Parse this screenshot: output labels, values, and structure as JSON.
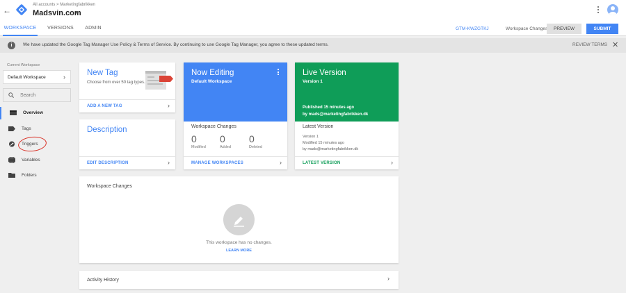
{
  "header": {
    "breadcrumb": "All accounts > Marketingfabrikken",
    "account_name": "Madsvin.com",
    "back_icon": "arrow-left-icon",
    "logo_icon": "gtm-logo-icon"
  },
  "nav": {
    "tabs": [
      {
        "label": "WORKSPACE",
        "active": true
      },
      {
        "label": "VERSIONS",
        "active": false
      },
      {
        "label": "ADMIN",
        "active": false
      }
    ],
    "container_id": "GTM-KWZGTKJ",
    "workspace_changes": "Workspace Changes: 0",
    "preview_label": "PREVIEW",
    "submit_label": "SUBMIT"
  },
  "notice": {
    "text": "We have updated the Google Tag Manager Use Policy & Terms of Service. By continuing to use Google Tag Manager, you agree to these updated terms.",
    "action": "REVIEW TERMS"
  },
  "sidebar": {
    "current_label": "Current Workspace",
    "workspace": "Default Workspace",
    "search_placeholder": "Search",
    "items": [
      {
        "label": "Overview",
        "icon": "overview-icon",
        "active": true
      },
      {
        "label": "Tags",
        "icon": "tag-icon",
        "active": false
      },
      {
        "label": "Triggers",
        "icon": "trigger-icon",
        "active": false
      },
      {
        "label": "Variables",
        "icon": "variables-icon",
        "active": false
      },
      {
        "label": "Folders",
        "icon": "folder-icon",
        "active": false
      }
    ]
  },
  "cards": {
    "new_tag": {
      "title": "New Tag",
      "desc": "Choose from over 50 tag types.",
      "link": "ADD A NEW TAG"
    },
    "description": {
      "title": "Description",
      "link": "EDIT DESCRIPTION"
    },
    "now_editing": {
      "title": "Now Editing",
      "subtitle": "Default Workspace",
      "section": "Workspace Changes",
      "stats": [
        {
          "value": "0",
          "label": "Modified"
        },
        {
          "value": "0",
          "label": "Added"
        },
        {
          "value": "0",
          "label": "Deleted"
        }
      ],
      "link": "MANAGE WORKSPACES",
      "color": "#4285f4"
    },
    "live_version": {
      "title": "Live Version",
      "subtitle": "Version 1",
      "published": "Published 15 minutes ago",
      "by": "by mads@marketingfabrikken.dk",
      "section": "Latest Version",
      "lines": [
        "Version 1",
        "Modified 15 minutes ago",
        "by mads@marketingfabrikken.dk"
      ],
      "link": "LATEST VERSION",
      "color": "#0f9d58"
    },
    "workspace_changes": {
      "title": "Workspace Changes",
      "empty": "This workspace has no changes.",
      "link": "LEARN MORE"
    },
    "activity_history": {
      "title": "Activity History"
    }
  }
}
